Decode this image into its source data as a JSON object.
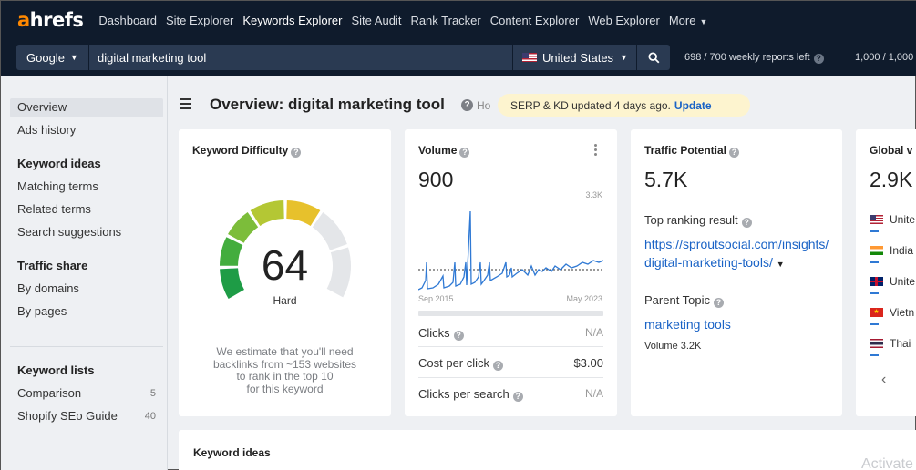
{
  "nav": {
    "logo_prefix": "a",
    "logo_rest": "hrefs",
    "items": [
      {
        "label": "Dashboard"
      },
      {
        "label": "Site Explorer"
      },
      {
        "label": "Keywords Explorer"
      },
      {
        "label": "Site Audit"
      },
      {
        "label": "Rank Tracker"
      },
      {
        "label": "Content Explorer"
      },
      {
        "label": "Web Explorer"
      },
      {
        "label": "More"
      }
    ],
    "active": "Keywords Explorer"
  },
  "search": {
    "engine": "Google",
    "query": "digital marketing tool",
    "country": "United States",
    "reports_left": "698 / 700 weekly reports left",
    "credits": "1,000 / 1,000"
  },
  "sidebar": {
    "overview": "Overview",
    "ads_history": "Ads history",
    "keyword_ideas_head": "Keyword ideas",
    "matching_terms": "Matching terms",
    "related_terms": "Related terms",
    "search_suggestions": "Search suggestions",
    "traffic_share_head": "Traffic share",
    "by_domains": "By domains",
    "by_pages": "By pages",
    "keyword_lists_head": "Keyword lists",
    "comparison": "Comparison",
    "comparison_count": "5",
    "shopify": "Shopify SEo Guide",
    "shopify_count": "40"
  },
  "header": {
    "title": "Overview: digital marketing tool",
    "help_text": "Ho",
    "serp_text": "SERP & KD updated 4 days ago.",
    "serp_link": "Update"
  },
  "kd": {
    "title": "Keyword Difficulty",
    "score": "64",
    "score_value": 64,
    "label": "Hard",
    "desc_line1": "We estimate that you'll need",
    "desc_line2": "backlinks from ~153 websites",
    "desc_line3": "to rank in the top 10",
    "desc_line4": "for this keyword"
  },
  "volume": {
    "title": "Volume",
    "value": "900",
    "chart_max": "3.3K",
    "chart_start": "Sep 2015",
    "chart_end": "May 2023",
    "clicks_label": "Clicks",
    "clicks_value": "N/A",
    "cpc_label": "Cost per click",
    "cpc_value": "$3.00",
    "cps_label": "Clicks per search",
    "cps_value": "N/A"
  },
  "traffic": {
    "title": "Traffic Potential",
    "value": "5.7K",
    "top_result_label": "Top ranking result",
    "top_result_url": "https://sproutsocial.com/insights/digital-marketing-tools/",
    "parent_label": "Parent Topic",
    "parent_topic": "marketing tools",
    "parent_volume": "Volume 3.2K"
  },
  "global": {
    "title": "Global v",
    "value": "2.9K",
    "countries": [
      {
        "name": "Unite",
        "flag": "us"
      },
      {
        "name": "India",
        "flag": "in"
      },
      {
        "name": "Unite",
        "flag": "uk"
      },
      {
        "name": "Vietn",
        "flag": "vn"
      },
      {
        "name": "Thai",
        "flag": "th"
      }
    ]
  },
  "bottom": {
    "title": "Keyword ideas",
    "watermark": "Activate"
  }
}
